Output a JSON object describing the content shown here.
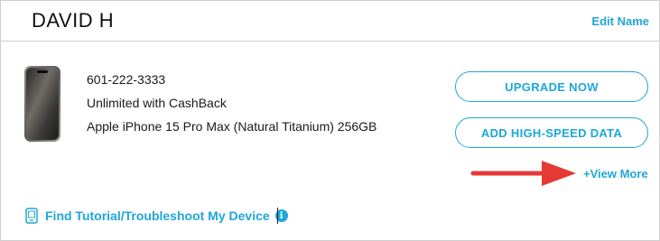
{
  "header": {
    "owner_name": "DAVID H",
    "edit_label": "Edit Name"
  },
  "line": {
    "phone_number": "601-222-3333",
    "plan": "Unlimited with CashBack",
    "device": "Apple iPhone 15 Pro Max (Natural Titanium) 256GB"
  },
  "actions": {
    "upgrade_label": "UPGRADE NOW",
    "data_label": "ADD HIGH-SPEED DATA",
    "view_more_label": "+View More"
  },
  "footer": {
    "tutorial_label": "Find Tutorial/Troubleshoot My Device",
    "info_glyph": "i"
  },
  "colors": {
    "accent": "#1ea7d8",
    "annotation_arrow": "#e53935"
  }
}
